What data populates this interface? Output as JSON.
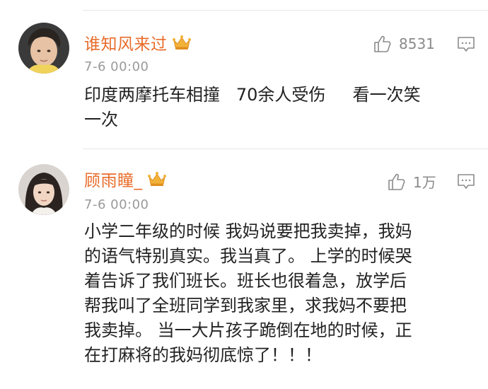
{
  "comments": [
    {
      "username": "谁知风来过",
      "time": "7-6 00:00",
      "likes": "8531",
      "avatar": "avatar-young-man",
      "badge": "vip-crown-icon",
      "lines": [
        "印度两摩托车相撞   70余人受伤     看一次笑",
        "一次"
      ]
    },
    {
      "username": "顾雨瞳_",
      "time": "7-6 00:00",
      "likes": "1万",
      "avatar": "avatar-young-woman",
      "badge": "vip-crown-icon",
      "lines": [
        "小学二年级的时候 我妈说要把我卖掉，我妈",
        "的语气特别真实。我当真了。 上学的时候哭",
        "着告诉了我们班长。班长也很着急，放学后",
        "帮我叫了全班同学到我家里，求我妈不要把",
        "我卖掉。 当一大片孩子跪倒在地的时候，正",
        "在打麻将的我妈彻底惊了！！！"
      ]
    }
  ],
  "colors": {
    "username": "#e86c2a",
    "meta": "#9a9a9a",
    "text": "#222222",
    "divider": "#e6e6e6",
    "crown": "#f2b23a"
  }
}
